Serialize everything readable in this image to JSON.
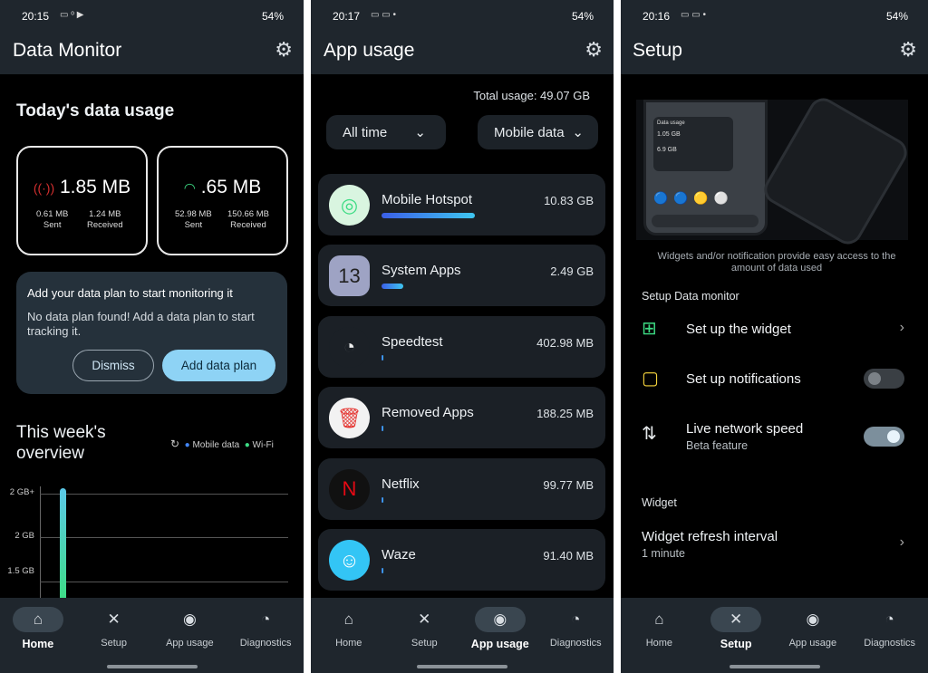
{
  "screens": [
    {
      "status": {
        "time": "20:15",
        "icons": "▭ ᵒ ▶",
        "right": "54%"
      },
      "title": "Data Monitor"
    },
    {
      "status": {
        "time": "20:17",
        "icons": "▭ ▭ •",
        "right": "54%"
      },
      "title": "App usage"
    },
    {
      "status": {
        "time": "20:16",
        "icons": "▭ ▭ •",
        "right": "54%"
      },
      "title": "Setup"
    }
  ],
  "home": {
    "today_title": "Today's data usage",
    "mobile": {
      "total": "1.85 MB",
      "sent": "0.61 MB",
      "sent_label": "Sent",
      "received": "1.24 MB",
      "received_label": "Received",
      "color": "#d32f2f"
    },
    "wifi": {
      "total": ".65 MB",
      "sent": "52.98 MB",
      "sent_label": "Sent",
      "received": "150.66 MB",
      "received_label": "Received",
      "color": "#3ddc84"
    },
    "plan": {
      "title": "Add your data plan to start monitoring it",
      "body": "No data plan found! Add a data plan to start tracking it.",
      "dismiss": "Dismiss",
      "add": "Add data plan"
    },
    "week_title": "This week's overview",
    "legend": {
      "mobile": "Mobile data",
      "wifi": "Wi-Fi"
    }
  },
  "chart_data": {
    "type": "bar",
    "title": "This week's overview",
    "y_ticks": [
      "2 GB+",
      "2 GB",
      "1.5 GB"
    ],
    "series": [
      {
        "name": "Wi-Fi",
        "color": "#3ddc84"
      },
      {
        "name": "Mobile data",
        "color": "#4285f4"
      }
    ],
    "bars": [
      {
        "day_index": 0,
        "value": "2 GB+"
      }
    ],
    "grid": true,
    "legend": "top-right"
  },
  "usage": {
    "total": "Total usage: 49.07 GB",
    "period": "All time",
    "type": "Mobile data",
    "apps": [
      {
        "name": "Mobile Hotspot",
        "value": "10.83 GB",
        "fraction": 1.0
      },
      {
        "name": "System Apps",
        "value": "2.49 GB",
        "fraction": 0.23
      },
      {
        "name": "Speedtest",
        "value": "402.98 MB",
        "fraction": 0.02
      },
      {
        "name": "Removed Apps",
        "value": "188.25 MB",
        "fraction": 0.01
      },
      {
        "name": "Netflix",
        "value": "99.77 MB",
        "fraction": 0.01
      },
      {
        "name": "Waze",
        "value": "91.40 MB",
        "fraction": 0.01
      }
    ]
  },
  "setup": {
    "caption": "Widgets and/or notification provide easy access to the amount of data used",
    "widget_preview": {
      "title": "Data usage",
      "mobile": "1.05 GB",
      "wifi": "6.9 GB"
    },
    "section1": "Setup Data monitor",
    "widget": "Set up the widget",
    "notifications": {
      "label": "Set up notifications",
      "on": false
    },
    "live": {
      "label": "Live network speed",
      "sub": "Beta feature",
      "on": true
    },
    "section2": "Widget",
    "refresh": {
      "label": "Widget refresh interval",
      "value": "1 minute"
    }
  },
  "nav": [
    "Home",
    "Setup",
    "App usage",
    "Diagnostics"
  ]
}
